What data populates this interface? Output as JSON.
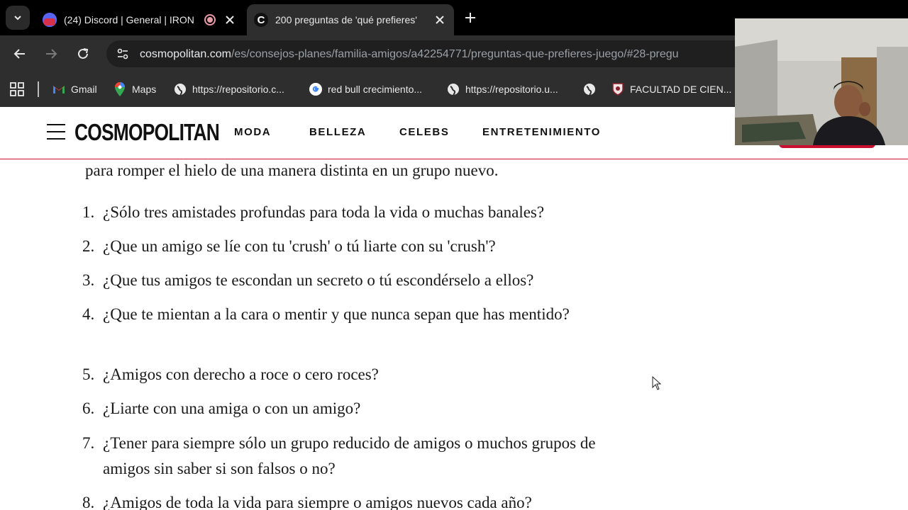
{
  "tabs": [
    {
      "title": "(24) Discord | General | IRON",
      "badge": "24",
      "state": "inactive"
    },
    {
      "title": "200 preguntas de 'qué prefieres'",
      "favicon_letter": "C",
      "state": "active"
    }
  ],
  "address_bar": {
    "host": "cosmopolitan.com",
    "path": "/es/consejos-planes/familia-amigos/a42254771/preguntas-que-prefieres-juego/#28-pregu"
  },
  "bookmarks": [
    {
      "label": "Gmail",
      "icon": "gmail-icon"
    },
    {
      "label": "Maps",
      "icon": "maps-pin-icon"
    },
    {
      "label": "https://repositorio.c...",
      "icon": "globe-icon"
    },
    {
      "label": "red bull crecimiento...",
      "icon": "google-icon"
    },
    {
      "label": "https://repositorio.u...",
      "icon": "globe-icon"
    },
    {
      "label": "",
      "icon": "globe-icon"
    },
    {
      "label": "FACULTAD DE CIEN...",
      "icon": "university-crest-icon"
    }
  ],
  "site": {
    "logo": "COSMOPOLITAN",
    "nav": [
      "MODA",
      "BELLEZA",
      "CELEBS",
      "ENTRETENIMIENTO"
    ],
    "accent": "#c8102e"
  },
  "article": {
    "intro": "para romper el hielo de una manera distinta en un grupo nuevo.",
    "questions": [
      {
        "num": "1.",
        "text": "¿Sólo tres amistades profundas para toda la vida o muchas banales?"
      },
      {
        "num": "2.",
        "text": "¿Que un amigo se líe con tu 'crush' o tú liarte con su 'crush'?"
      },
      {
        "num": "3.",
        "text": "¿Que tus amigos te escondan un secreto o tú escondérselo a ellos?"
      },
      {
        "num": "4.",
        "text": "¿Que te mientan a la cara o mentir y que nunca sepan que has mentido?"
      },
      {
        "num": "5.",
        "text": "¿Amigos con derecho a roce o cero roces?"
      },
      {
        "num": "6.",
        "text": "¿Liarte con una amiga o con un amigo?"
      },
      {
        "num": "7.",
        "text": "¿Tener para siempre sólo un grupo reducido de amigos o muchos grupos de amigos sin saber si son falsos o no?"
      },
      {
        "num": "8.",
        "text": "¿Amigos de toda la vida para siempre o amigos nuevos cada año?"
      }
    ]
  }
}
